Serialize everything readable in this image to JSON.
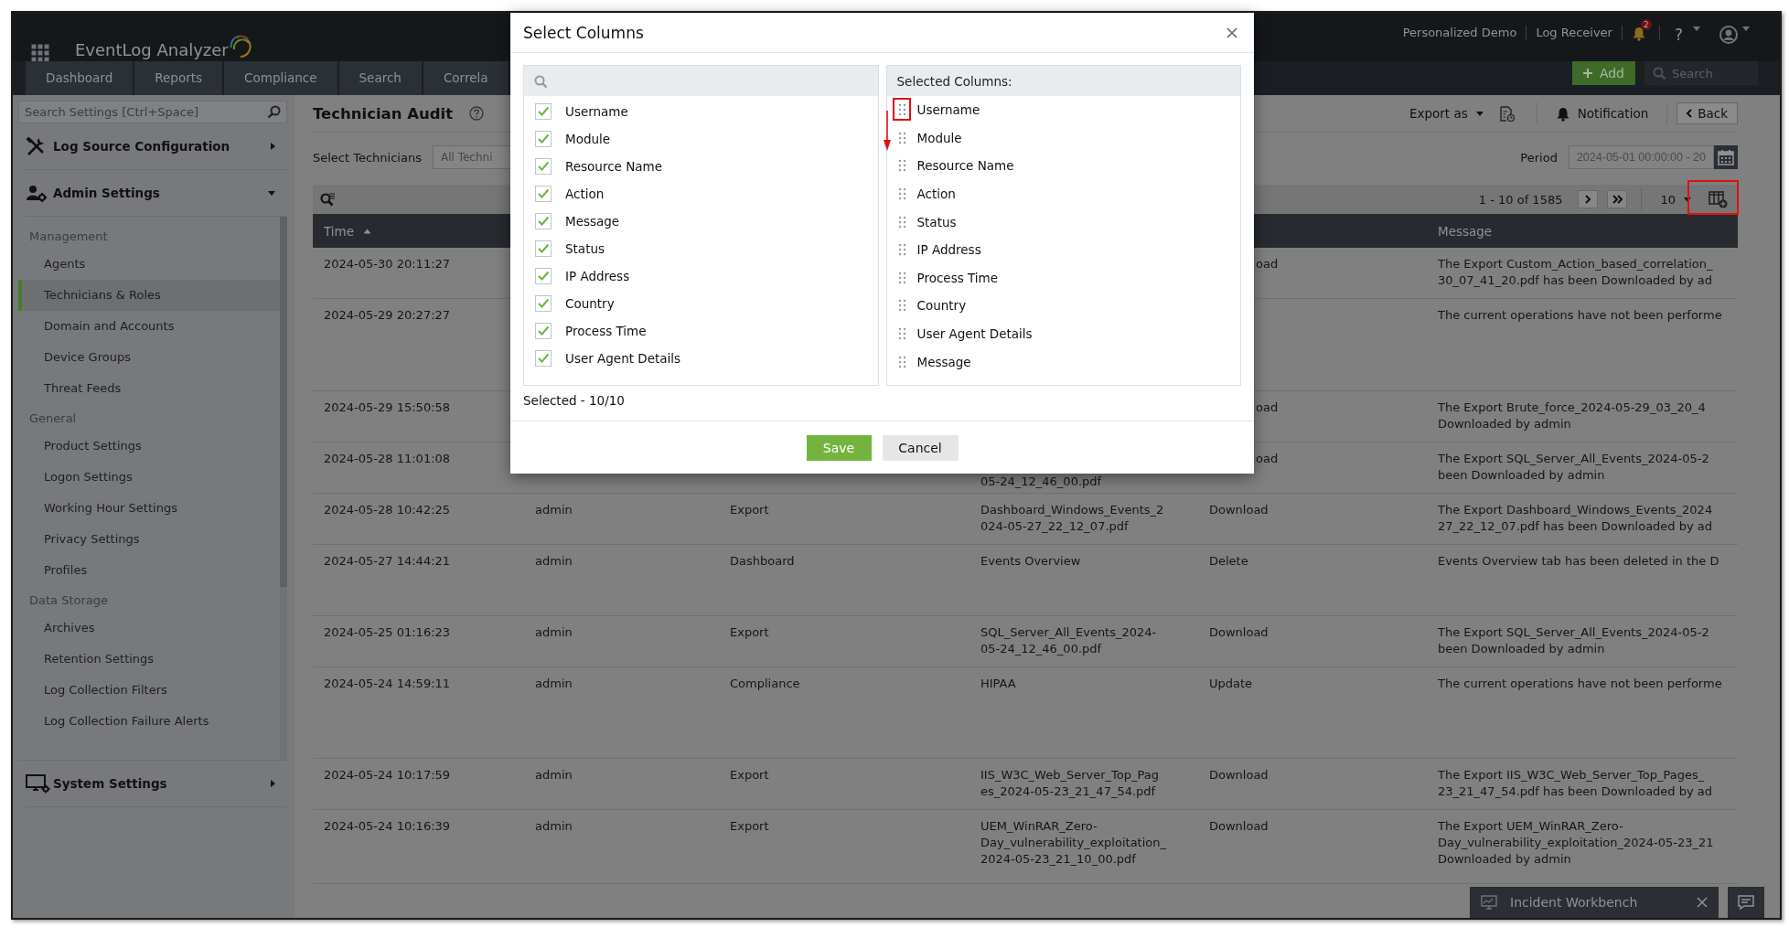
{
  "app": {
    "title": "EventLog Analyzer"
  },
  "top_links": [
    "Personalized Demo",
    "Log Receiver"
  ],
  "notification_badge": "2",
  "help_label": "?",
  "nav_tabs": [
    {
      "label": "Dashboard"
    },
    {
      "label": "Reports"
    },
    {
      "label": "Compliance"
    },
    {
      "label": "Search"
    },
    {
      "label": "Correla"
    }
  ],
  "add_button": "Add",
  "header_search": {
    "placeholder": "Search"
  },
  "sidebar": {
    "search": {
      "placeholder": "Search Settings [Ctrl+Space]"
    },
    "groups": [
      {
        "label": "Log Source Configuration",
        "kind": "tools",
        "expanded": false
      },
      {
        "label": "Admin Settings",
        "kind": "user-gear",
        "expanded": true,
        "sections": [
          {
            "title": "Management",
            "items": [
              {
                "label": "Agents",
                "selected": false
              },
              {
                "label": "Technicians & Roles",
                "selected": true
              },
              {
                "label": "Domain and Accounts",
                "selected": false
              },
              {
                "label": "Device Groups",
                "selected": false
              },
              {
                "label": "Threat Feeds",
                "selected": false
              }
            ]
          },
          {
            "title": "General",
            "items": [
              {
                "label": "Product Settings",
                "selected": false
              },
              {
                "label": "Logon Settings",
                "selected": false
              },
              {
                "label": "Working Hour Settings",
                "selected": false
              },
              {
                "label": "Privacy Settings",
                "selected": false
              },
              {
                "label": "Profiles",
                "selected": false
              }
            ]
          },
          {
            "title": "Data Storage",
            "items": [
              {
                "label": "Archives",
                "selected": false
              },
              {
                "label": "Retention Settings",
                "selected": false
              },
              {
                "label": "Log Collection Filters",
                "selected": false
              },
              {
                "label": "Log Collection Failure Alerts",
                "selected": false
              }
            ]
          }
        ]
      },
      {
        "label": "System Settings",
        "kind": "monitor-gear",
        "expanded": false
      }
    ]
  },
  "page": {
    "title": "Technician Audit",
    "toolbar": {
      "export": "Export as",
      "notification": "Notification",
      "back": "Back"
    },
    "technicians": {
      "label": "Select Technicians",
      "value": "All Techni"
    },
    "period": {
      "label": "Period",
      "value": "2024-05-01 00:00:00 - 20"
    },
    "pagination": {
      "range": "1 - 10 of 1585",
      "page_size": "10"
    }
  },
  "table": {
    "columns": [
      {
        "label": "Time",
        "sorted": true
      },
      {
        "label": "Message",
        "sorted": false
      }
    ],
    "rows": [
      {
        "time": "2024-05-30 20:11:27",
        "action_tail": "oad",
        "message": "The Export Custom_Action_based_correlation_\n30_07_41_20.pdf has been Downloaded by ad"
      },
      {
        "time": "2024-05-29 20:27:27",
        "message": "The current operations have not been performe"
      },
      {
        "time": "2024-05-29 15:50:58",
        "action_tail": "oad",
        "message": "The Export Brute_force_2024-05-29_03_20_4\nDownloaded by admin"
      },
      {
        "time": "2024-05-28 11:01:08",
        "resource_name_tail": "05-24_12_46_00.pdf",
        "action_tail": "oad",
        "message": "The Export SQL_Server_All_Events_2024-05-2\nbeen Downloaded by admin"
      },
      {
        "time": "2024-05-28 10:42:25",
        "username": "admin",
        "module": "Export",
        "resource_name": "Dashboard_Windows_Events_2\n024-05-27_22_12_07.pdf",
        "action": "Download",
        "message": "The Export Dashboard_Windows_Events_2024\n27_22_12_07.pdf has been Downloaded by ad"
      },
      {
        "time": "2024-05-27 14:44:21",
        "username": "admin",
        "module": "Dashboard",
        "resource_name": "Events Overview",
        "action": "Delete",
        "message": "Events Overview tab has been deleted in the D"
      },
      {
        "time": "2024-05-25 01:16:23",
        "username": "admin",
        "module": "Export",
        "resource_name": "SQL_Server_All_Events_2024-\n05-24_12_46_00.pdf",
        "action": "Download",
        "message": "The Export SQL_Server_All_Events_2024-05-2\nbeen Downloaded by admin"
      },
      {
        "time": "2024-05-24 14:59:11",
        "username": "admin",
        "module": "Compliance",
        "resource_name": "HIPAA",
        "action": "Update",
        "message": "The current operations have not been performe"
      },
      {
        "time": "2024-05-24 10:17:59",
        "username": "admin",
        "module": "Export",
        "resource_name": "IIS_W3C_Web_Server_Top_Pag\nes_2024-05-23_21_47_54.pdf",
        "action": "Download",
        "message": "The Export IIS_W3C_Web_Server_Top_Pages_\n23_21_47_54.pdf has been Downloaded by ad"
      },
      {
        "time": "2024-05-24 10:16:39",
        "username": "admin",
        "module": "Export",
        "resource_name": "UEM_WinRAR_Zero-\nDay_vulnerability_exploitation_\n2024-05-23_21_10_00.pdf",
        "action": "Download",
        "message": "The Export UEM_WinRAR_Zero-\nDay_vulnerability_exploitation_2024-05-23_21\nDownloaded by admin"
      }
    ]
  },
  "incident_workbench": "Incident Workbench",
  "dialog": {
    "title": "Select Columns",
    "available": {
      "items": [
        {
          "label": "Username",
          "checked": true
        },
        {
          "label": "Module",
          "checked": true
        },
        {
          "label": "Resource Name",
          "checked": true
        },
        {
          "label": "Action",
          "checked": true
        },
        {
          "label": "Message",
          "checked": true
        },
        {
          "label": "Status",
          "checked": true
        },
        {
          "label": "IP Address",
          "checked": true
        },
        {
          "label": "Country",
          "checked": true
        },
        {
          "label": "Process Time",
          "checked": true
        },
        {
          "label": "User Agent Details",
          "checked": true
        }
      ]
    },
    "selected": {
      "title": "Selected Columns:",
      "items": [
        "Username",
        "Module",
        "Resource Name",
        "Action",
        "Status",
        "IP Address",
        "Process Time",
        "Country",
        "User Agent Details",
        "Message"
      ]
    },
    "count": "Selected - 10/10",
    "buttons": [
      {
        "label": "Save",
        "kind": "primary"
      },
      {
        "label": "Cancel",
        "kind": "secondary"
      }
    ]
  }
}
